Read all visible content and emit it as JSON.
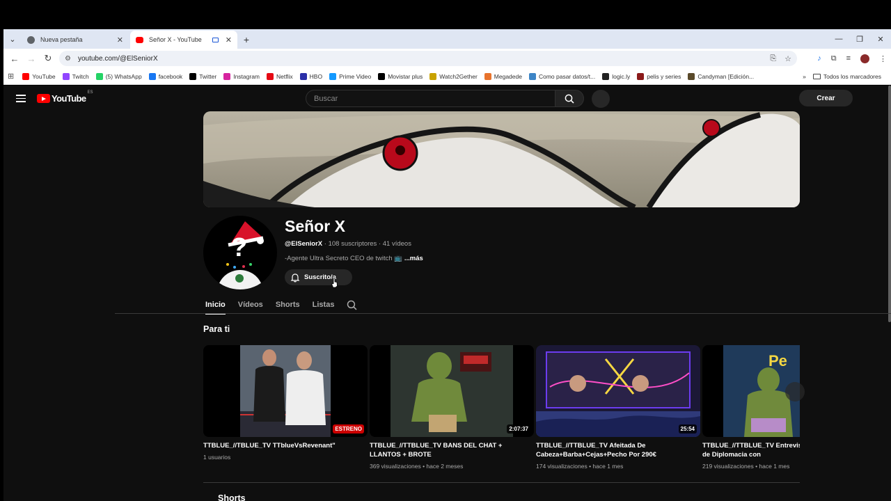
{
  "browser": {
    "tabs": [
      {
        "title": "Nueva pestaña",
        "active": false,
        "favicon_color": "#5f6368"
      },
      {
        "title": "Señor X - YouTube",
        "active": true,
        "favicon_color": "#ff0000"
      }
    ],
    "url": "youtube.com/@ElSeniorX",
    "bookmarks": [
      {
        "label": "YouTube",
        "color": "#ff0000"
      },
      {
        "label": "Twitch",
        "color": "#9146ff"
      },
      {
        "label": "(5) WhatsApp",
        "color": "#25d366"
      },
      {
        "label": "facebook",
        "color": "#1877f2"
      },
      {
        "label": "Twitter",
        "color": "#000000"
      },
      {
        "label": "Instagram",
        "color": "#d6249f"
      },
      {
        "label": "Netflix",
        "color": "#e50914"
      },
      {
        "label": "HBO",
        "color": "#2b2fa8"
      },
      {
        "label": "Prime Video",
        "color": "#1399ff"
      },
      {
        "label": "Movistar plus",
        "color": "#000000"
      },
      {
        "label": "Watch2Gether",
        "color": "#c8a200"
      },
      {
        "label": "Megadede",
        "color": "#e8732c"
      },
      {
        "label": "Como pasar datos/t...",
        "color": "#3d85c6"
      },
      {
        "label": "logic.ly",
        "color": "#222222"
      },
      {
        "label": "pelis y series",
        "color": "#8b1a1a"
      },
      {
        "label": "Candyman [Edición...",
        "color": "#5a4a2a"
      }
    ],
    "bookmarks_more": "»",
    "all_bookmarks": "Todos los marcadores"
  },
  "youtube": {
    "logo_text": "YouTube",
    "logo_region": "ES",
    "search_placeholder": "Buscar",
    "create_label": "Crear",
    "channel": {
      "name": "Señor X",
      "handle": "@ElSeniorX",
      "subscribers": "108 suscriptores",
      "videos": "41 vídeos",
      "description": "-Agente Ultra Secreto CEO de twitch",
      "more": "...más",
      "subscribed_label": "Suscrito/a"
    },
    "tabs": [
      "Inicio",
      "Vídeos",
      "Shorts",
      "Listas"
    ],
    "section_title": "Para ti",
    "videos": [
      {
        "title": "TTBLUE_//TBLUE_TV TTblueVsRevenant\"",
        "meta": "1 usuarios",
        "badge": "ESTRENO",
        "badge_red": true
      },
      {
        "title": "TTBLUE_//TTBLUE_TV BANS DEL CHAT + LLANTOS + BROTE",
        "meta": "369 visualizaciones • hace 2 meses",
        "badge": "2:07:37",
        "badge_red": false
      },
      {
        "title": "TTBLUE_//TTBLUE_TV Afeitada De Cabeza+Barba+Cejas+Pecho Por 290€",
        "meta": "174 visualizaciones • hace 1 mes",
        "badge": "25:54",
        "badge_red": false
      },
      {
        "title": "TTBLUE_//TTBLUE_TV Entrevista Intento fallido de Diplomacia con",
        "meta": "219 visualizaciones • hace 1 mes",
        "badge": "",
        "badge_red": false
      }
    ],
    "shorts_title": "Shorts"
  }
}
